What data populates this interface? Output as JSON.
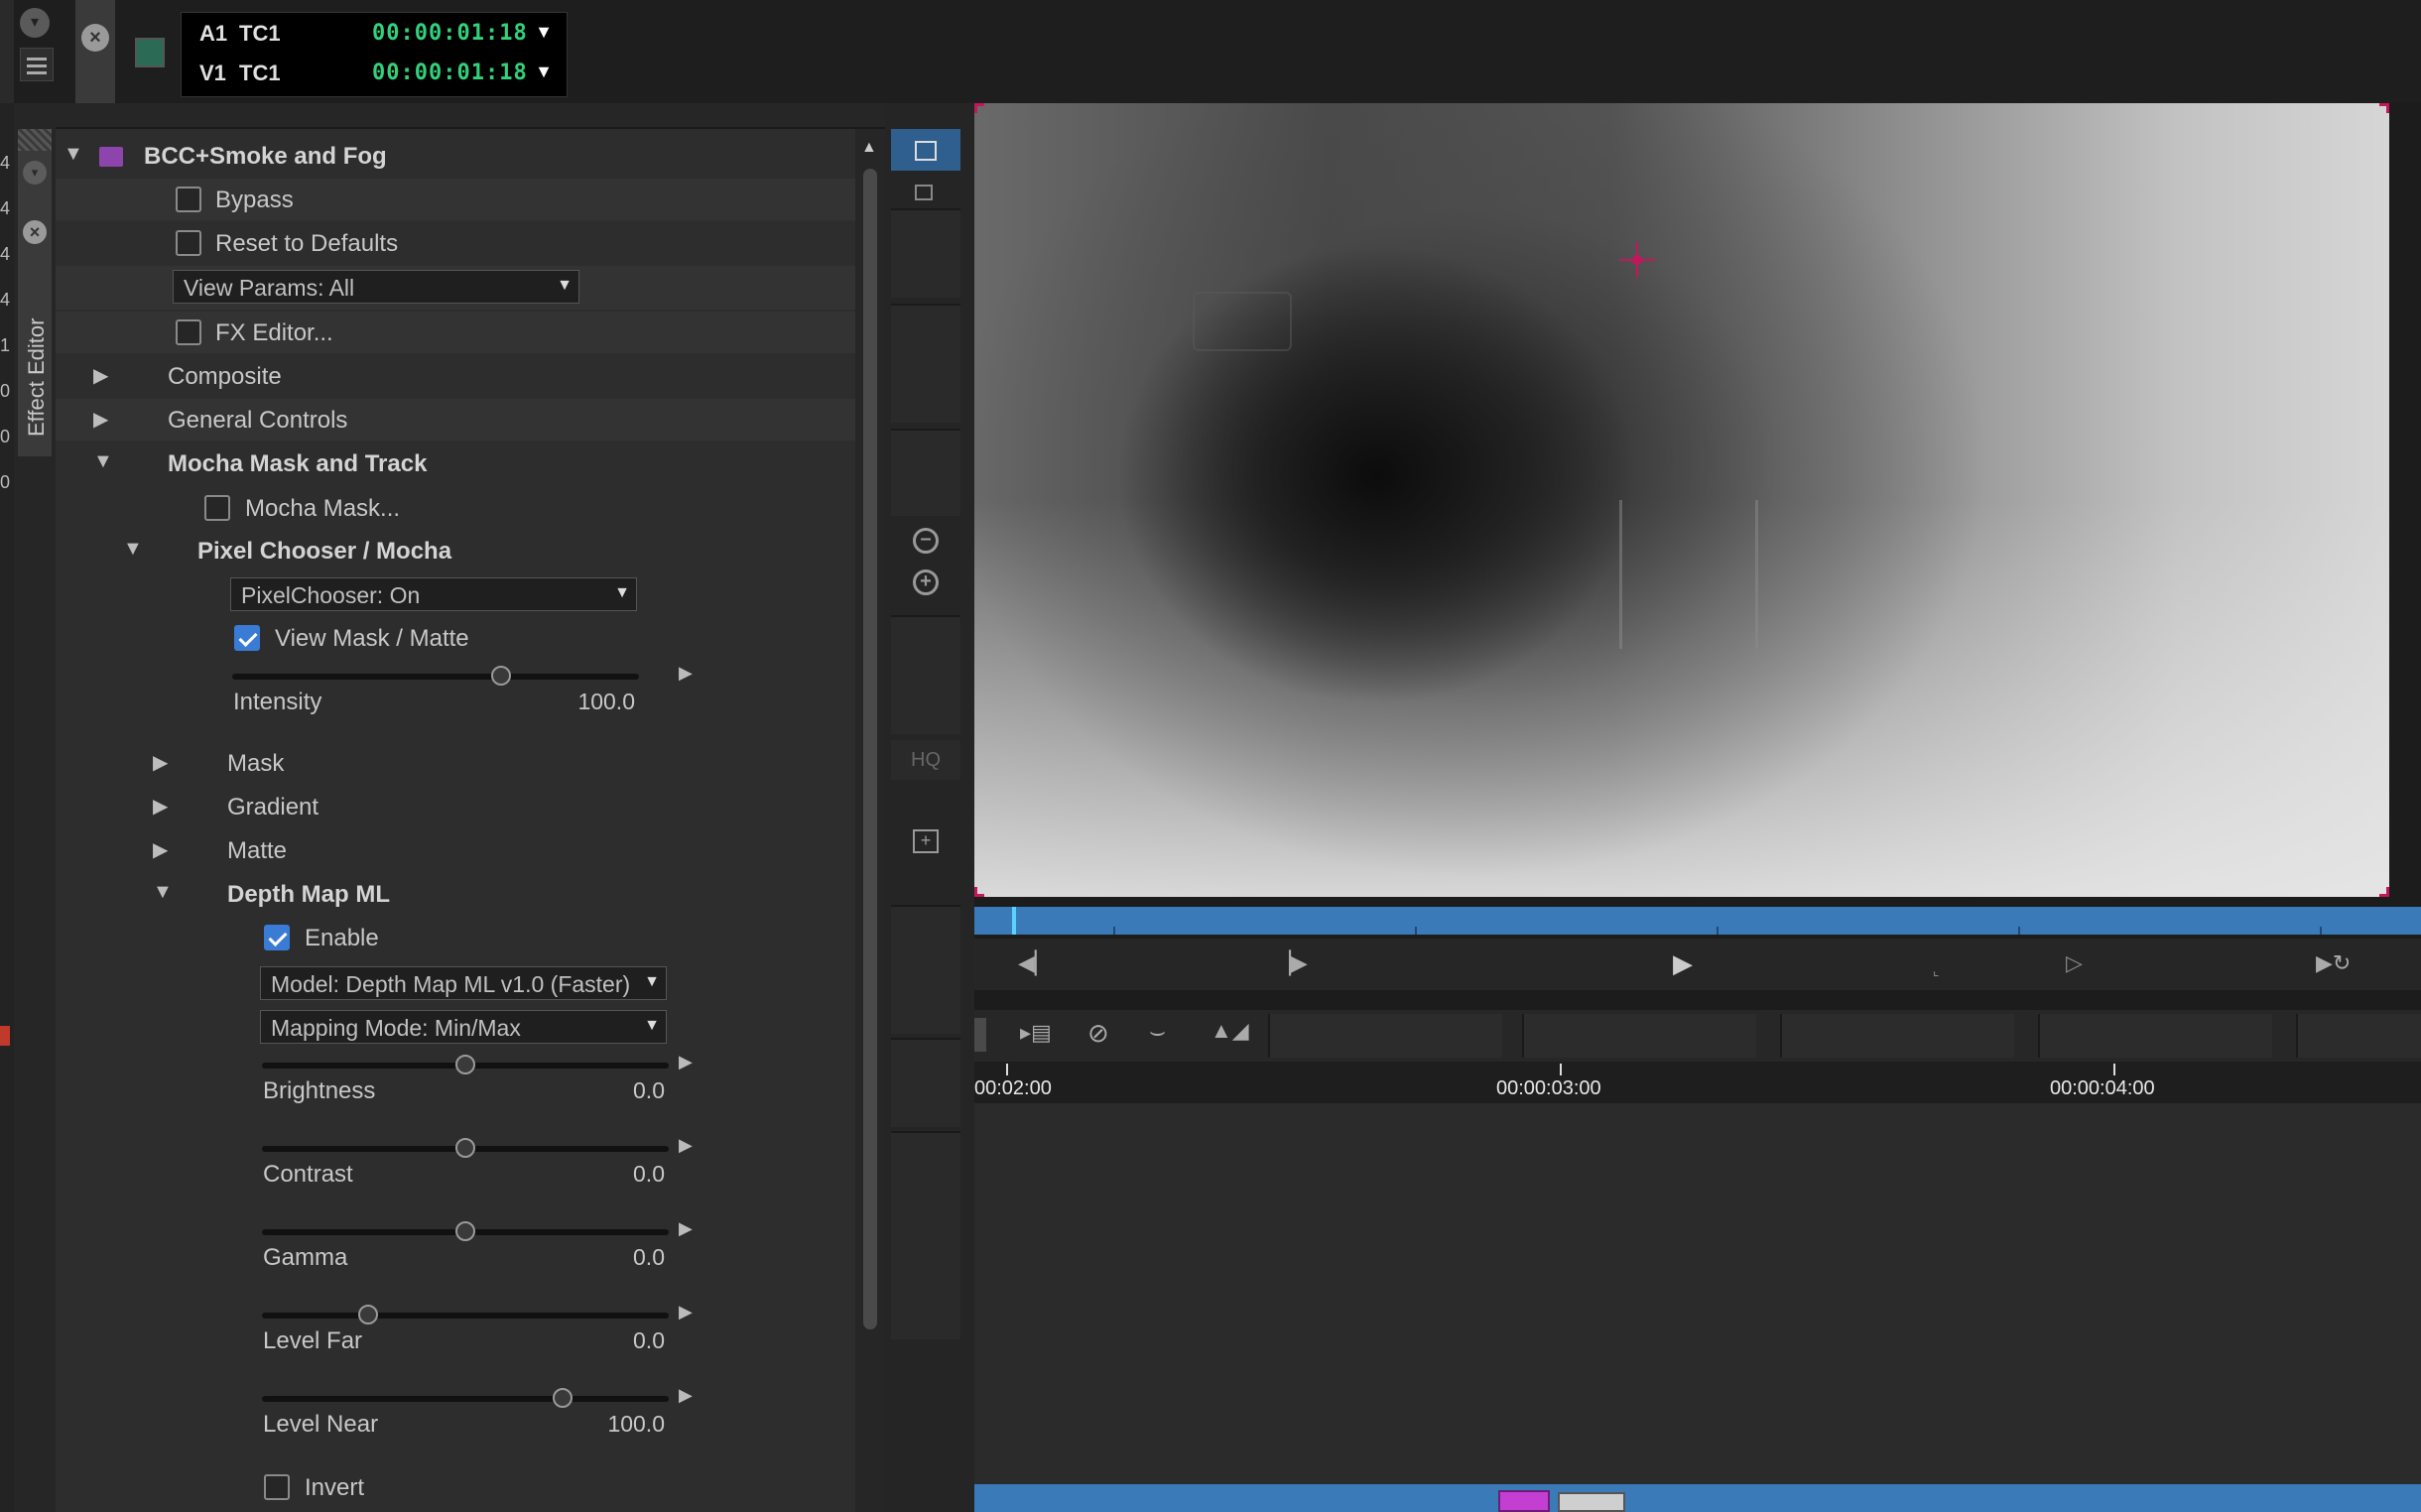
{
  "timecode": {
    "rows": [
      {
        "track": "A1",
        "label": "TC1",
        "value": "00:00:01:18"
      },
      {
        "track": "V1",
        "label": "TC1",
        "value": "00:00:01:18"
      }
    ]
  },
  "side_tab": {
    "label": "Effect Editor"
  },
  "effect": {
    "name": "BCC+Smoke and Fog",
    "bypass": "Bypass",
    "reset": "Reset to Defaults",
    "view_params": "View Params: All",
    "fx_editor": "FX Editor...",
    "composite": "Composite",
    "general_controls": "General Controls",
    "mocha_group": "Mocha Mask and Track",
    "mocha_mask": "Mocha Mask...",
    "pixel_chooser": "Pixel Chooser / Mocha",
    "pixelchooser_dd": "PixelChooser: On",
    "view_mask": "View Mask / Matte",
    "intensity": {
      "label": "Intensity",
      "value": "100.0",
      "level": 0.66
    },
    "mask": "Mask",
    "gradient": "Gradient",
    "matte": "Matte",
    "depth_group": "Depth Map ML",
    "enable": "Enable",
    "model_dd": "Model: Depth Map ML v1.0 (Faster)",
    "mapping_dd": "Mapping Mode: Min/Max",
    "brightness": {
      "label": "Brightness",
      "value": "0.0",
      "level": 0.5
    },
    "contrast": {
      "label": "Contrast",
      "value": "0.0",
      "level": 0.5
    },
    "gamma": {
      "label": "Gamma",
      "value": "0.0",
      "level": 0.5
    },
    "level_far": {
      "label": "Level Far",
      "value": "0.0",
      "level": 0.26
    },
    "level_near": {
      "label": "Level Near",
      "value": "100.0",
      "level": 0.74
    },
    "invert": "Invert"
  },
  "tool_strip": {
    "hq": "HQ"
  },
  "timeline": {
    "ticks": [
      "00:02:00",
      "00:00:03:00",
      "00:00:04:00"
    ]
  },
  "left_edge_digits": [
    "4",
    "4",
    "4",
    "4",
    "1",
    "0",
    "0",
    "0"
  ]
}
